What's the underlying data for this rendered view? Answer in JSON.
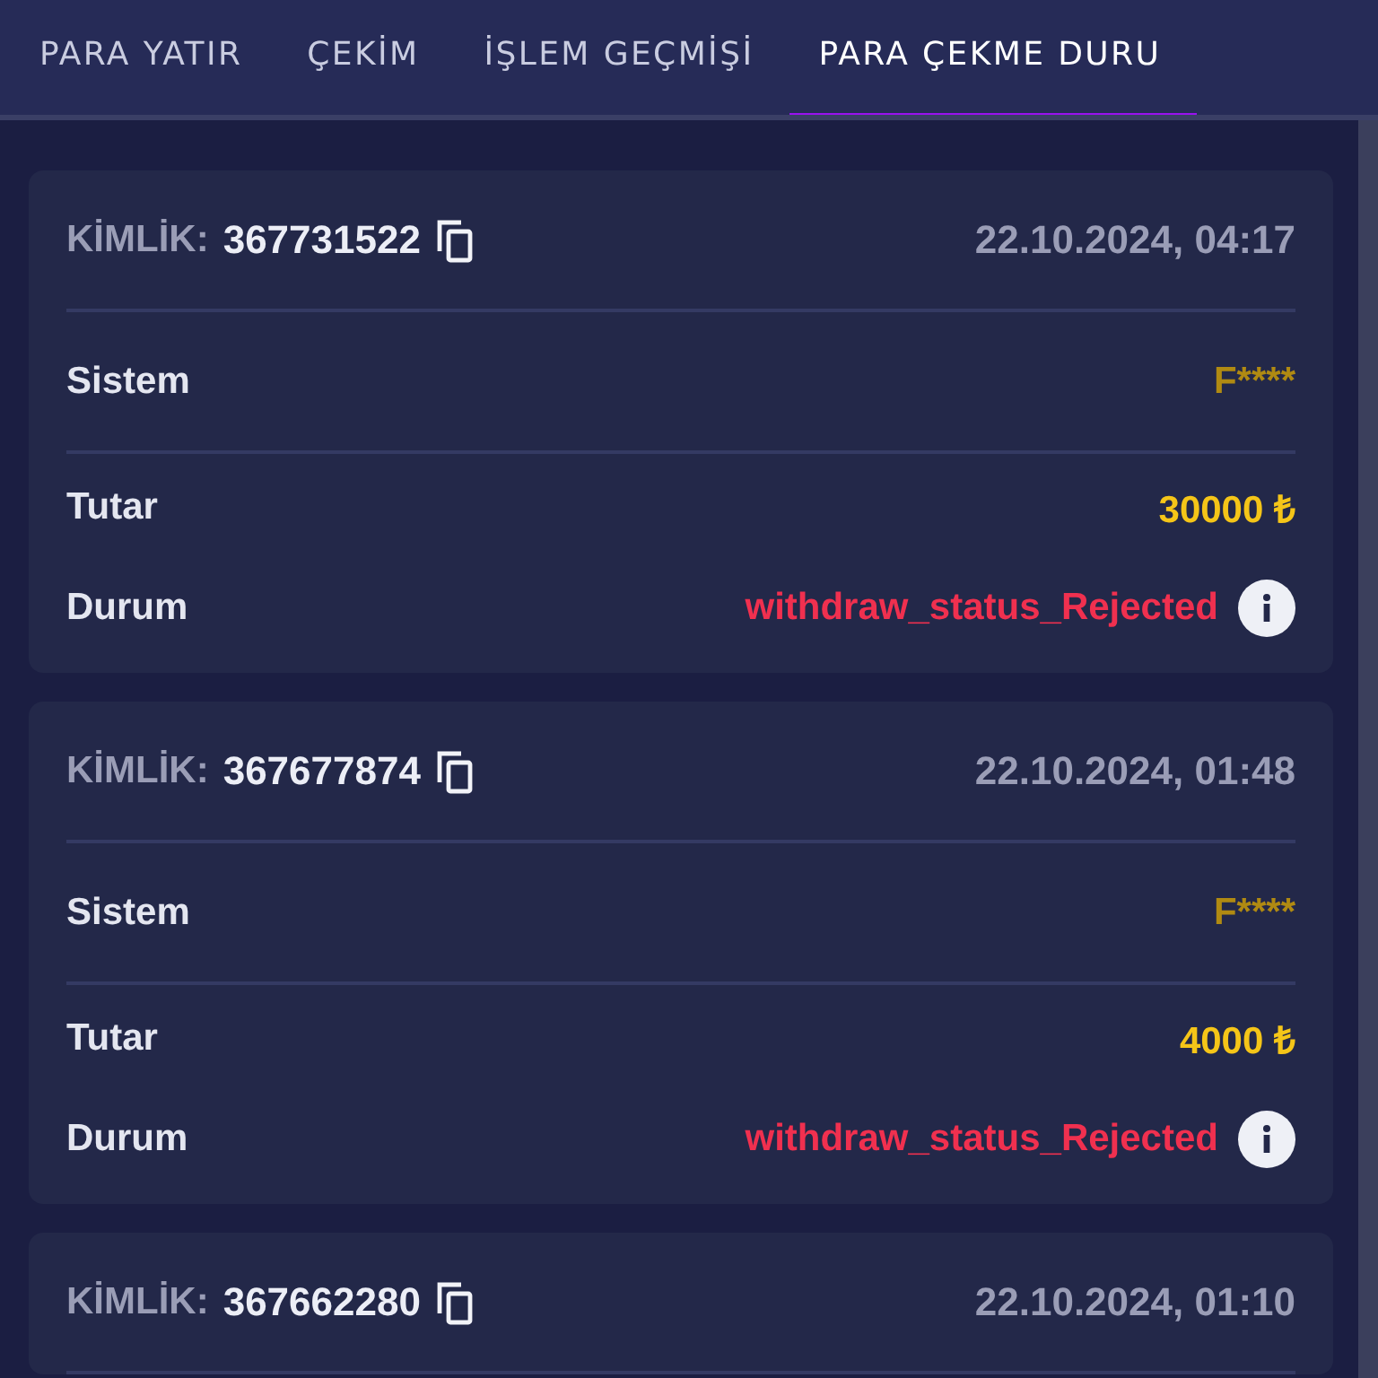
{
  "tabs": [
    {
      "label": "PARA YATIR",
      "selected": false
    },
    {
      "label": "ÇEKİM",
      "selected": false
    },
    {
      "label": "İŞLEM GEÇMİŞİ",
      "selected": false
    },
    {
      "label": "PARA ÇEKME DURU",
      "selected": true
    }
  ],
  "withdrawals": [
    {
      "id_label": "KİMLİK:",
      "id": "367731522",
      "date": "22.10.2024, 04:17",
      "rows": [
        {
          "label": "Sistem",
          "value": "F****",
          "kind": "system"
        },
        {
          "label": "Tutar",
          "value": "30000 ₺",
          "kind": "amount"
        },
        {
          "label": "Durum",
          "value": "withdraw_status_Rejected",
          "kind": "status"
        }
      ]
    },
    {
      "id_label": "KİMLİK:",
      "id": "367677874",
      "date": "22.10.2024, 01:48",
      "rows": [
        {
          "label": "Sistem",
          "value": "F****",
          "kind": "system"
        },
        {
          "label": "Tutar",
          "value": "4000 ₺",
          "kind": "amount"
        },
        {
          "label": "Durum",
          "value": "withdraw_status_Rejected",
          "kind": "status"
        }
      ]
    },
    {
      "id_label": "KİMLİK:",
      "id": "367662280",
      "date": "22.10.2024, 01:10"
    }
  ]
}
